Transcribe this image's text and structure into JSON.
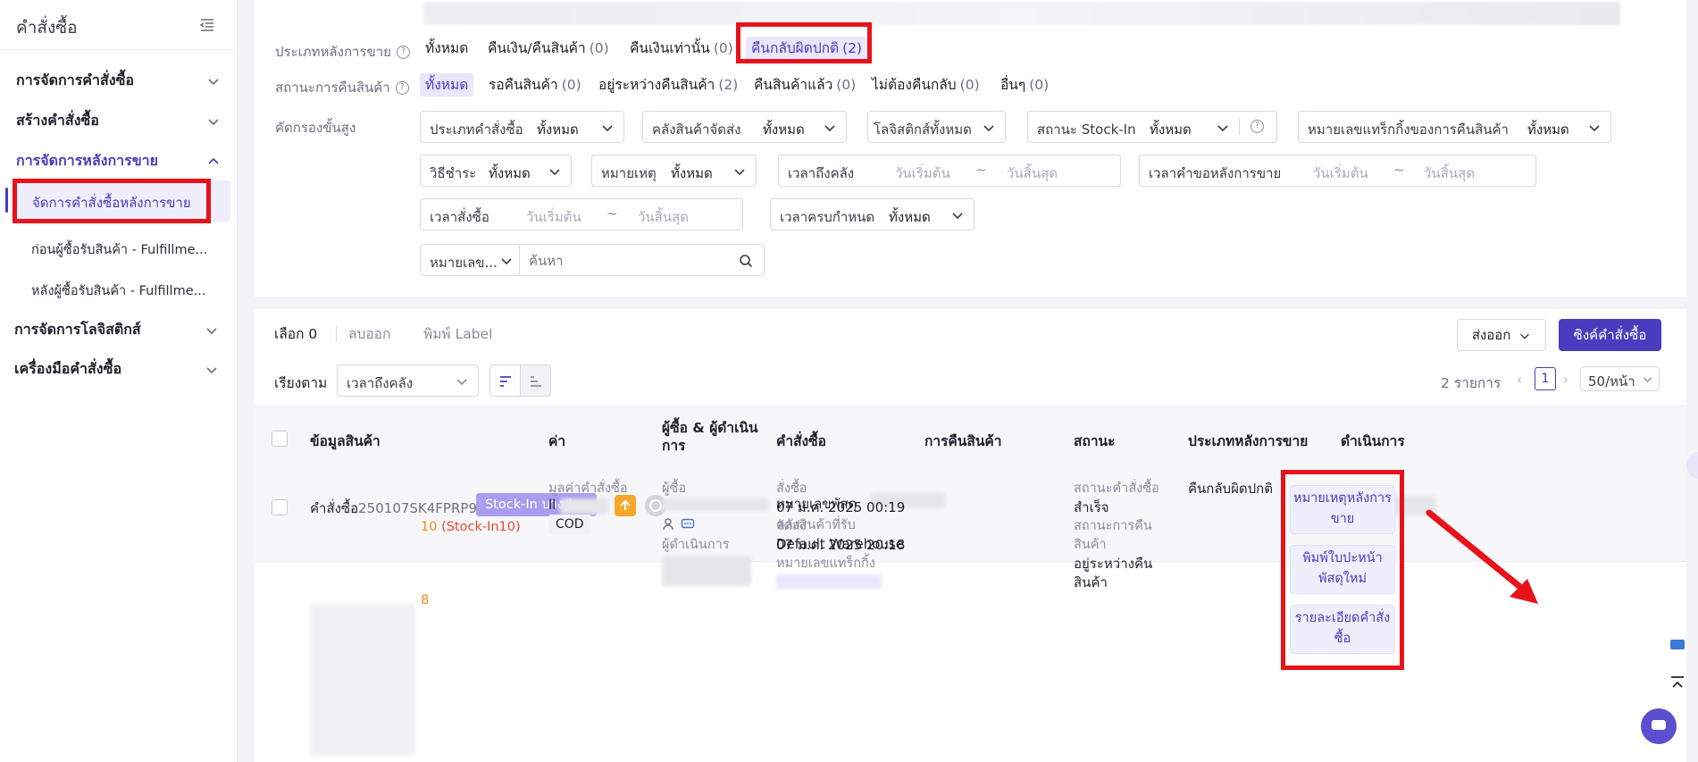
{
  "sidebar": {
    "title": "คำสั่งซื้อ",
    "groups": [
      {
        "label": "การจัดการคำสั่งซื้อ"
      },
      {
        "label": "สร้างคำสั่งซื้อ"
      },
      {
        "label": "การจัดการหลังการขาย"
      },
      {
        "label": "การจัดการโลจิสติกส์"
      },
      {
        "label": "เครื่องมือคำสั่งซื้อ"
      }
    ],
    "subitems": [
      {
        "label": "จัดการคำสั่งซื้อหลังการขาย"
      },
      {
        "label": "ก่อนผู้ซื้อรับสินค้า - Fulfillme..."
      },
      {
        "label": "หลังผู้ซื้อรับสินค้า - Fulfillme..."
      }
    ]
  },
  "filters": {
    "aftersale_type": {
      "label": "ประเภทหลังการขาย",
      "options": [
        {
          "label": "ทั้งหมด",
          "count": ""
        },
        {
          "label": "คืนเงิน/คืนสินค้า",
          "count": "(0)"
        },
        {
          "label": "คืนเงินเท่านั้น",
          "count": "(0)"
        },
        {
          "label": "คืนกลับผิดปกติ",
          "count": "(2)"
        }
      ]
    },
    "return_status": {
      "label": "สถานะการคืนสินค้า",
      "options": [
        {
          "label": "ทั้งหมด",
          "count": ""
        },
        {
          "label": "รอคืนสินค้า",
          "count": "(0)"
        },
        {
          "label": "อยู่ระหว่างคืนสินค้า",
          "count": "(2)"
        },
        {
          "label": "คืนสินค้าแล้ว",
          "count": "(0)"
        },
        {
          "label": "ไม่ต้องคืนกลับ",
          "count": "(0)"
        },
        {
          "label": "อื่นๆ",
          "count": "(0)"
        }
      ]
    },
    "advanced": {
      "label": "คัดกรองขั้นสูง",
      "order_type": {
        "label": "ประเภทคำสั่งซื้อ",
        "value": "ทั้งหมด"
      },
      "warehouse": {
        "label": "คลังสินค้าจัดส่ง",
        "value": "ทั้งหมด"
      },
      "logistics": {
        "label": "โลจิสติกส์ทั้งหมด"
      },
      "stockin": {
        "label": "สถานะ Stock-In",
        "value": "ทั้งหมด"
      },
      "return_tracking": {
        "label": "หมายเลขแทร็กกิ้งของการคืนสินค้า",
        "value": "ทั้งหมด"
      },
      "payment": {
        "label": "วิธีชำระ",
        "value": "ทั้งหมด"
      },
      "note": {
        "label": "หมายเหตุ",
        "value": "ทั้งหมด"
      },
      "arrive_time": {
        "label": "เวลาถึงคลัง",
        "start": "วันเริ่มต้น",
        "end": "วันสิ้นสุด"
      },
      "request_time": {
        "label": "เวลาคำขอหลังการขาย",
        "start": "วันเริ่มต้น",
        "end": "วันสิ้นสุด"
      },
      "order_time": {
        "label": "เวลาสั่งซื้อ",
        "start": "วันเริ่มต้น",
        "end": "วันสิ้นสุด"
      },
      "deadline": {
        "label": "เวลาครบกำหนด",
        "value": "ทั้งหมด"
      },
      "search_field": {
        "label": "หมายเลข..."
      },
      "search": {
        "placeholder": "ค้นหา"
      },
      "tilde": "~"
    }
  },
  "toolbar": {
    "selected": "เลือก 0",
    "remove": "ลบออก",
    "print_label": "พิมพ์ Label",
    "export": "ส่งออก",
    "sync": "ซิงค์คำสั่งซื้อ",
    "sort_label": "เรียงตาม",
    "sort_value": "เวลาถึงคลัง",
    "total": "2 รายการ",
    "page": "1",
    "page_size": "50/หน้า"
  },
  "table": {
    "columns": [
      "ข้อมูลสินค้า",
      "ค่า",
      "ผู้ซื้อ & ผู้ดำเนินการ",
      "คำสั่งซื้อ",
      "การคืนสินค้า",
      "สถานะ",
      "ประเภทหลังการขาย",
      "ดำเนินการ"
    ],
    "order": {
      "id_label": "คำสั่งซื้อ",
      "id": "250107SK4FPRP9",
      "stockin_tag": "Stock-In บางส่วน",
      "tracking_label": "หมายเลขพัสดุ",
      "warehouse_label": "คลังสินค้าที่รับ",
      "warehouse": "Default Warehouse",
      "qty_main": "10",
      "qty_stockin": "(Stock-In10)",
      "qty_second": "8",
      "amount_label": "มูลค่าคำสั่งซื้อ",
      "amount_prefix": "ll",
      "payment": "COD",
      "buyer_label": "ผู้ซื้อ",
      "operator_label": "ผู้ดำเนินการ",
      "order_label": "สั่งซื้อ",
      "order_time": "07 ม.ค. 2025 00:19",
      "ship_label": "จัดส่ง",
      "ship_time": "07 ม.ค. 2025 20:18",
      "track_label": "หมายเลขแทร็กกิ้ง",
      "status_order_label": "สถานะคำสั่งซื้อ",
      "status_order": "สำเร็จ",
      "status_return_label1": "สถานะการคืน",
      "status_return_label2": "สินค้า",
      "status_return1": "อยู่ระหว่างคืน",
      "status_return2": "สินค้า",
      "aftersale_type": "คืนกลับผิดปกติ",
      "actions": [
        {
          "line1": "หมายเหตุหลังการ",
          "line2": "ขาย"
        },
        {
          "line1": "พิมพ์ใบปะหน้า",
          "line2": "พัสดุใหม่"
        },
        {
          "line1": "รายละเอียดคำสั่ง",
          "line2": "ซื้อ"
        }
      ]
    }
  },
  "colors": {
    "accent": "#4b3bbf",
    "annotation": "#e8121b",
    "warning": "#f08a24"
  }
}
